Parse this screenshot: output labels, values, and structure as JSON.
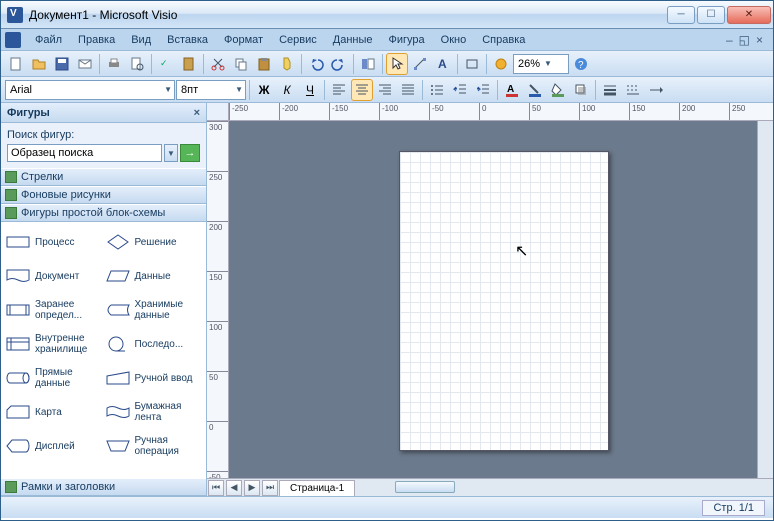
{
  "window": {
    "title": "Документ1 - Microsoft Visio"
  },
  "menu": {
    "file": "Файл",
    "edit": "Правка",
    "view": "Вид",
    "insert": "Вставка",
    "format": "Формат",
    "tools": "Сервис",
    "data": "Данные",
    "shape": "Фигура",
    "window": "Окно",
    "help": "Справка"
  },
  "toolbar": {
    "zoom": "26%"
  },
  "format": {
    "font": "Arial",
    "size": "8пт"
  },
  "panel": {
    "title": "Фигуры",
    "search_label": "Поиск фигур:",
    "search_placeholder": "Образец поиска",
    "stencils": {
      "arrows": "Стрелки",
      "backgrounds": "Фоновые рисунки",
      "flowchart": "Фигуры простой блок-схемы",
      "frames": "Рамки и заголовки"
    },
    "shapes": [
      {
        "name": "Процесс"
      },
      {
        "name": "Решение"
      },
      {
        "name": "Документ"
      },
      {
        "name": "Данные"
      },
      {
        "name": "Заранее определ..."
      },
      {
        "name": "Хранимые данные"
      },
      {
        "name": "Внутренне хранилище"
      },
      {
        "name": "Последо..."
      },
      {
        "name": "Прямые данные"
      },
      {
        "name": "Ручной ввод"
      },
      {
        "name": "Карта"
      },
      {
        "name": "Бумажная лента"
      },
      {
        "name": "Дисплей"
      },
      {
        "name": "Ручная операция"
      }
    ]
  },
  "tabs": {
    "page1": "Страница-1"
  },
  "status": {
    "page": "Стр. 1/1"
  }
}
